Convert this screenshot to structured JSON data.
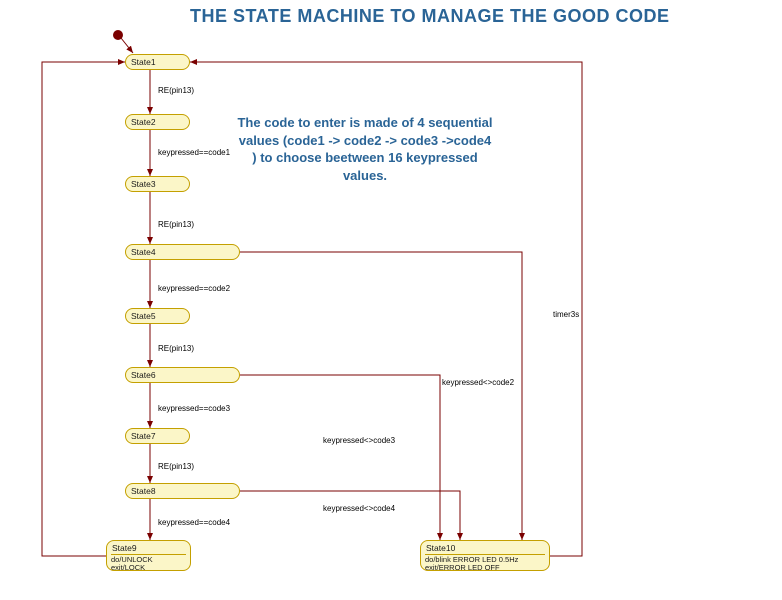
{
  "title": "THE STATE MACHINE TO MANAGE THE GOOD CODE",
  "description": "The code to enter is made of 4 sequential values (code1 -> code2 -> code3 ->code4 ) to choose beetween 16 keypressed values.",
  "states": {
    "s1": {
      "name": "State1"
    },
    "s2": {
      "name": "State2"
    },
    "s3": {
      "name": "State3"
    },
    "s4": {
      "name": "State4"
    },
    "s5": {
      "name": "State5"
    },
    "s6": {
      "name": "State6"
    },
    "s7": {
      "name": "State7"
    },
    "s8": {
      "name": "State8"
    },
    "s9": {
      "name": "State9",
      "line1": "do/UNLOCK",
      "line2": "exit/LOCK"
    },
    "s10": {
      "name": "State10",
      "line1": "do/blink ERROR LED 0.5Hz",
      "line2": "exit/ERROR LED OFF"
    }
  },
  "transitions": {
    "t1_2": "RE(pin13)",
    "t2_3": "keypressed==code1",
    "t3_4": "RE(pin13)",
    "t4_5": "keypressed==code2",
    "t5_6": "RE(pin13)",
    "t6_7": "keypressed==code3",
    "t7_8": "RE(pin13)",
    "t8_9": "keypressed==code4",
    "t4_10": "keypressed<>code2",
    "t6_10": "keypressed<>code3",
    "t8_10": "keypressed<>code4",
    "t10_1": "timer3s"
  },
  "chart_data": {
    "type": "state-machine",
    "initial": "State1",
    "states": [
      "State1",
      "State2",
      "State3",
      "State4",
      "State5",
      "State6",
      "State7",
      "State8",
      "State9",
      "State10"
    ],
    "state_actions": {
      "State9": {
        "do": "UNLOCK",
        "exit": "LOCK"
      },
      "State10": {
        "do": "blink ERROR LED 0.5Hz",
        "exit": "ERROR LED OFF"
      }
    },
    "transitions": [
      {
        "from": "initial",
        "to": "State1",
        "guard": ""
      },
      {
        "from": "State1",
        "to": "State2",
        "guard": "RE(pin13)"
      },
      {
        "from": "State2",
        "to": "State3",
        "guard": "keypressed==code1"
      },
      {
        "from": "State3",
        "to": "State4",
        "guard": "RE(pin13)"
      },
      {
        "from": "State4",
        "to": "State5",
        "guard": "keypressed==code2"
      },
      {
        "from": "State5",
        "to": "State6",
        "guard": "RE(pin13)"
      },
      {
        "from": "State6",
        "to": "State7",
        "guard": "keypressed==code3"
      },
      {
        "from": "State7",
        "to": "State8",
        "guard": "RE(pin13)"
      },
      {
        "from": "State8",
        "to": "State9",
        "guard": "keypressed==code4"
      },
      {
        "from": "State4",
        "to": "State10",
        "guard": "keypressed<>code2"
      },
      {
        "from": "State6",
        "to": "State10",
        "guard": "keypressed<>code3"
      },
      {
        "from": "State8",
        "to": "State10",
        "guard": "keypressed<>code4"
      },
      {
        "from": "State10",
        "to": "State1",
        "guard": "timer3s"
      },
      {
        "from": "State9",
        "to": "State1",
        "guard": ""
      }
    ]
  }
}
